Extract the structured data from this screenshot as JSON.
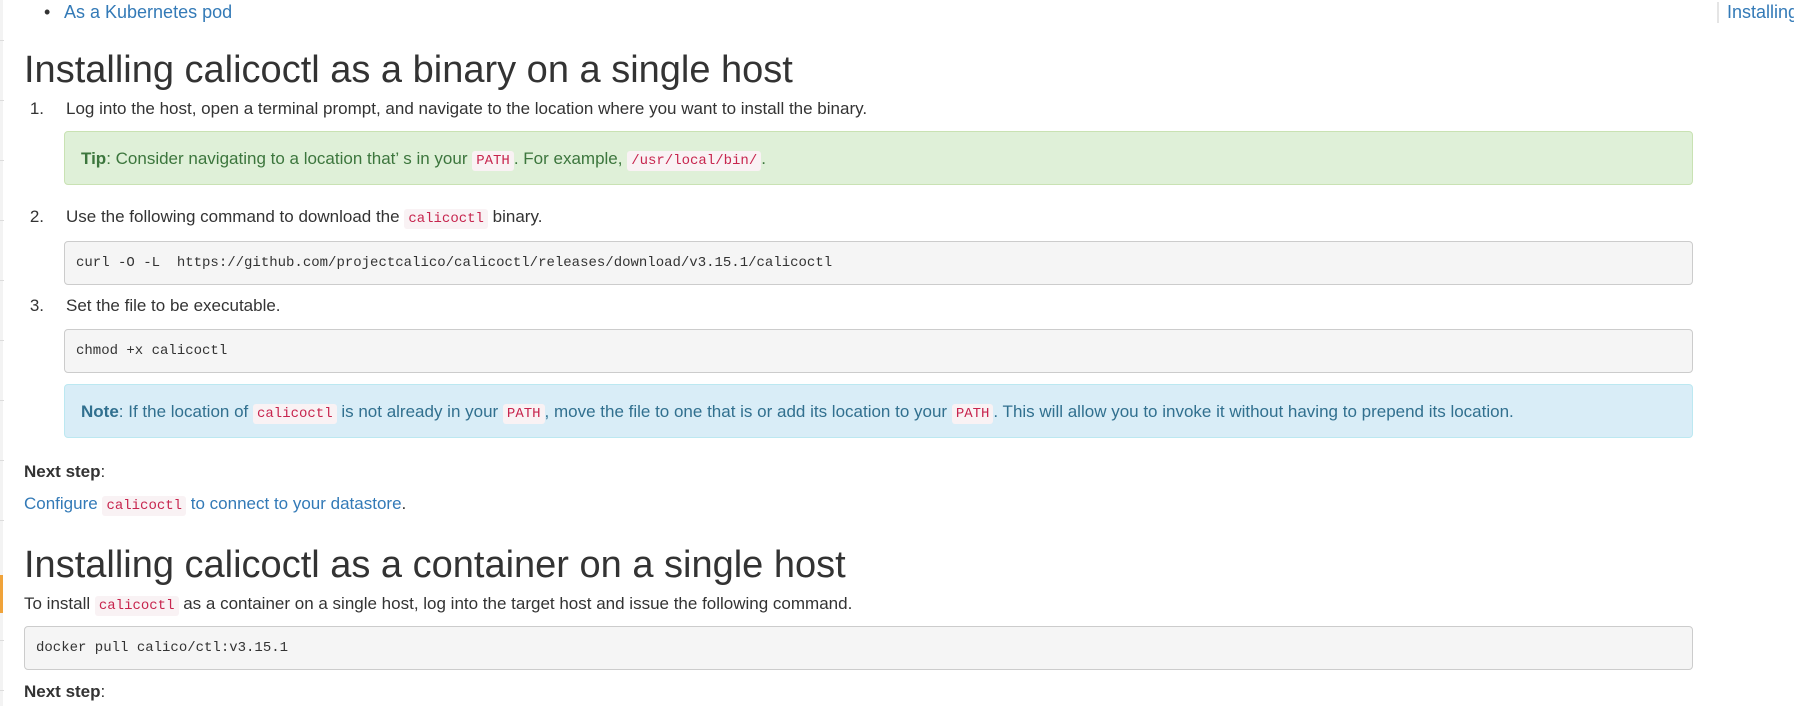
{
  "toc": {
    "current_label": "Installing"
  },
  "top_list": {
    "item_label": "As a Kubernetes pod"
  },
  "section1": {
    "heading": "Installing calicoctl as a binary on a single host",
    "step1": {
      "number": "1.",
      "text": "Log into the host, open a terminal prompt, and navigate to the location where you want to install the binary."
    },
    "tip": {
      "label": "Tip",
      "text_a": ": Consider navigating to a location that’ s in your ",
      "code_a": "PATH",
      "text_b": ". For example, ",
      "code_b": "/usr/local/bin/",
      "text_c": "."
    },
    "step2": {
      "number": "2.",
      "text_a": "Use the following command to download the ",
      "code": "calicoctl",
      "text_b": " binary."
    },
    "cmd_download": "curl -O -L  https://github.com/projectcalico/calicoctl/releases/download/v3.15.1/calicoctl",
    "step3": {
      "number": "3.",
      "text": "Set the file to be executable."
    },
    "cmd_chmod": "chmod +x calicoctl",
    "note": {
      "label": "Note",
      "text_a": ": If the location of ",
      "code_a": "calicoctl",
      "text_b": " is not already in your ",
      "code_b": "PATH",
      "text_c": ", move the file to one that is or add its location to your ",
      "code_c": "PATH",
      "text_d": ". This will allow you to invoke it without having to prepend its location."
    },
    "next_step_label": "Next step",
    "next_step_colon": ":",
    "configure": {
      "link_a": "Configure ",
      "code": "calicoctl",
      "link_b": " to connect to your datastore",
      "tail": "."
    }
  },
  "section2": {
    "heading": "Installing calicoctl as a container on a single host",
    "intro": {
      "text_a": "To install ",
      "code": "calicoctl",
      "text_b": " as a container on a single host, log into the target host and issue the following command."
    },
    "cmd_docker": "docker pull calico/ctl:v3.15.1",
    "next_step_label": "Next step",
    "next_step_colon": ":"
  }
}
